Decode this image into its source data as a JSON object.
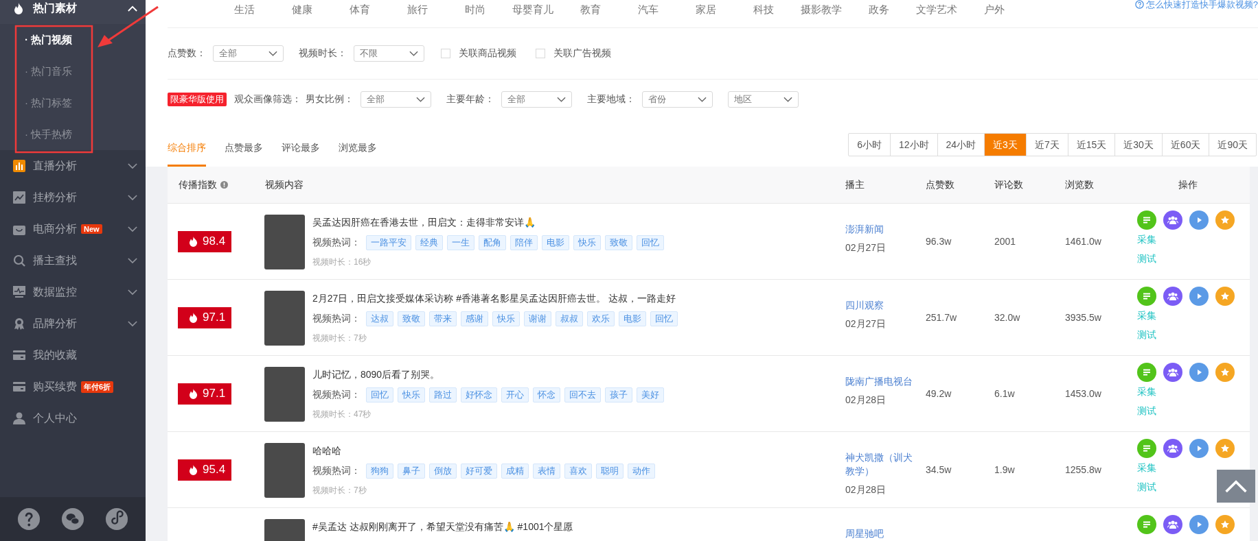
{
  "sidebar": {
    "items": [
      {
        "kind": "group",
        "label": "热门素材",
        "expanded": true,
        "children": [
          {
            "label": "· 热门视频",
            "selected": true
          },
          {
            "label": "· 热门音乐",
            "selected": false
          },
          {
            "label": "· 热门标签",
            "selected": false
          },
          {
            "label": "· 快手热榜",
            "selected": false
          }
        ]
      },
      {
        "kind": "group",
        "label": "直播分析",
        "expanded": false
      },
      {
        "kind": "group",
        "label": "挂榜分析",
        "expanded": false
      },
      {
        "kind": "group",
        "label": "电商分析",
        "expanded": false,
        "badge": "New"
      },
      {
        "kind": "group",
        "label": "播主查找",
        "expanded": false
      },
      {
        "kind": "group",
        "label": "数据监控",
        "expanded": false
      },
      {
        "kind": "group",
        "label": "品牌分析",
        "expanded": false
      },
      {
        "kind": "link",
        "label": "我的收藏"
      },
      {
        "kind": "link",
        "label": "购买续费",
        "badge": "年付6折"
      },
      {
        "kind": "link",
        "label": "个人中心"
      }
    ]
  },
  "categories": [
    "生活",
    "健康",
    "体育",
    "旅行",
    "时尚",
    "母婴育儿",
    "教育",
    "汽车",
    "家居",
    "科技",
    "摄影教学",
    "政务",
    "文学艺术",
    "户外"
  ],
  "help_link": "怎么快速打造快手爆款视频?",
  "filters": [
    {
      "kind": "select",
      "label": "点赞数：",
      "value": "全部"
    },
    {
      "kind": "select",
      "label": "视频时长：",
      "value": "不限"
    },
    {
      "kind": "checkbox",
      "label": "关联商品视频",
      "checked": false
    },
    {
      "kind": "checkbox",
      "label": "关联广告视频",
      "checked": false
    }
  ],
  "audience_filters": {
    "badge": "限豪华版使用",
    "title": "观众画像筛选：",
    "selects": [
      {
        "label": "男女比例：",
        "value": "全部"
      },
      {
        "label": "主要年龄：",
        "value": "全部"
      },
      {
        "label": "主要地域：",
        "value": "省份"
      },
      {
        "value": "地区"
      }
    ]
  },
  "sort_tabs": [
    {
      "label": "综合排序",
      "selected": true
    },
    {
      "label": "点赞最多",
      "selected": false
    },
    {
      "label": "评论最多",
      "selected": false
    },
    {
      "label": "浏览最多",
      "selected": false
    }
  ],
  "time_ranges": [
    {
      "label": "6小时",
      "selected": false
    },
    {
      "label": "12小时",
      "selected": false
    },
    {
      "label": "24小时",
      "selected": false
    },
    {
      "label": "近3天",
      "selected": true
    },
    {
      "label": "近7天",
      "selected": false
    },
    {
      "label": "近15天",
      "selected": false
    },
    {
      "label": "近30天",
      "selected": false
    },
    {
      "label": "近60天",
      "selected": false
    },
    {
      "label": "近90天",
      "selected": false
    }
  ],
  "table": {
    "columns": [
      "传播指数",
      "视频内容",
      "播主",
      "点赞数",
      "评论数",
      "浏览数",
      "操作"
    ],
    "rows": [
      {
        "score": "98.4",
        "title": "吴孟达因肝癌在香港去世，田启文：走得非常安详🙏",
        "keywords_label": "视频热词：",
        "keywords": [
          "一路平安",
          "经典",
          "一生",
          "配角",
          "陪伴",
          "电影",
          "快乐",
          "致敬",
          "回忆"
        ],
        "duration": "视频时长：16秒",
        "author": "澎湃新闻",
        "date": "02月27日",
        "likes": "96.3w",
        "comments": "2001",
        "views": "1461.0w",
        "actions": [
          "采集",
          "测试"
        ]
      },
      {
        "score": "97.1",
        "title": "2月27日，田启文接受媒体采访称 #香港著名影星吴孟达因肝癌去世。 达叔，一路走好",
        "keywords_label": "视频热词：",
        "keywords": [
          "达叔",
          "致敬",
          "带来",
          "感谢",
          "快乐",
          "谢谢",
          "叔叔",
          "欢乐",
          "电影",
          "回忆"
        ],
        "duration": "视频时长：7秒",
        "author": "四川观察",
        "date": "02月27日",
        "likes": "251.7w",
        "comments": "32.0w",
        "views": "3935.5w",
        "actions": [
          "采集",
          "测试"
        ]
      },
      {
        "score": "97.1",
        "title": "儿时记忆，8090后看了别哭。",
        "keywords_label": "视频热词：",
        "keywords": [
          "回忆",
          "快乐",
          "路过",
          "好怀念",
          "开心",
          "怀念",
          "回不去",
          "孩子",
          "美好"
        ],
        "duration": "视频时长：47秒",
        "author": "陇南广播电视台",
        "date": "02月28日",
        "likes": "49.2w",
        "comments": "6.1w",
        "views": "1453.0w",
        "actions": [
          "采集",
          "测试"
        ]
      },
      {
        "score": "95.4",
        "title": "哈哈哈",
        "keywords_label": "视频热词：",
        "keywords": [
          "狗狗",
          "鼻子",
          "倒放",
          "好可爱",
          "成精",
          "表情",
          "喜欢",
          "聪明",
          "动作"
        ],
        "duration": "视频时长：7秒",
        "author": "神犬凯撒（训犬教学）",
        "date": "02月28日",
        "likes": "34.5w",
        "comments": "1.9w",
        "views": "1255.8w",
        "actions": [
          "采集",
          "测试"
        ]
      },
      {
        "title": "#吴孟达 达叔刚刚离开了，希望天堂没有痛苦🙏 #1001个星愿",
        "author": "周星驰吧"
      }
    ]
  }
}
